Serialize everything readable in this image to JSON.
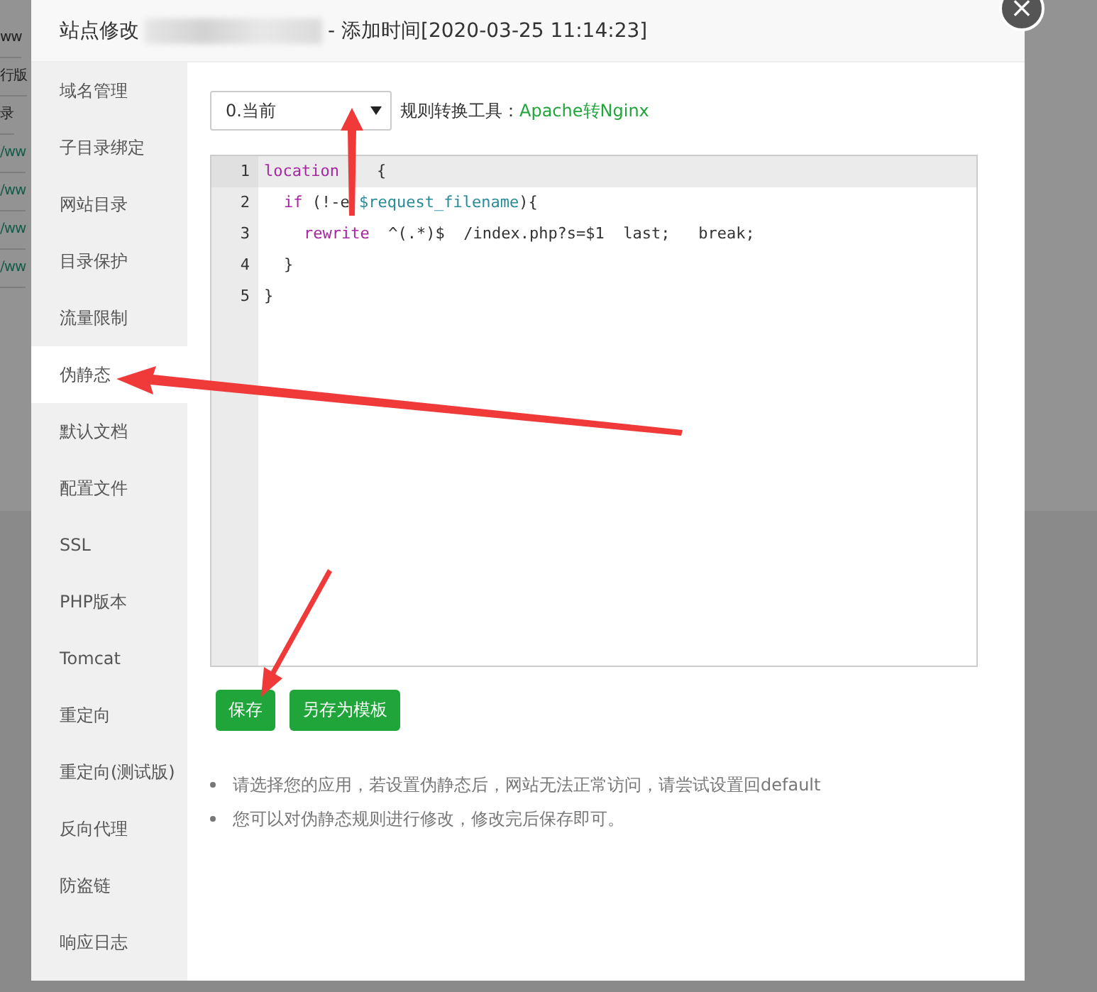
{
  "background": {
    "fragments": [
      "ww",
      "行版",
      "录",
      "/ww",
      "/ww",
      "/ww",
      "/ww"
    ]
  },
  "dialog": {
    "title_prefix": "站点修改",
    "title_suffix": "- 添加时间[2020-03-25 11:14:23]",
    "close": "×"
  },
  "sidebar": {
    "items": [
      {
        "label": "域名管理",
        "selected": false
      },
      {
        "label": "子目录绑定",
        "selected": false
      },
      {
        "label": "网站目录",
        "selected": false
      },
      {
        "label": "目录保护",
        "selected": false
      },
      {
        "label": "流量限制",
        "selected": false
      },
      {
        "label": "伪静态",
        "selected": true
      },
      {
        "label": "默认文档",
        "selected": false
      },
      {
        "label": "配置文件",
        "selected": false
      },
      {
        "label": "SSL",
        "selected": false
      },
      {
        "label": "PHP版本",
        "selected": false
      },
      {
        "label": "Tomcat",
        "selected": false
      },
      {
        "label": "重定向",
        "selected": false
      },
      {
        "label": "重定向(测试版)",
        "selected": false
      },
      {
        "label": "反向代理",
        "selected": false
      },
      {
        "label": "防盗链",
        "selected": false
      },
      {
        "label": "响应日志",
        "selected": false
      }
    ]
  },
  "rewrite": {
    "template_select": {
      "value": "0.当前"
    },
    "tool_label": "规则转换工具：",
    "tool_link": "Apache转Nginx",
    "editor": {
      "lines": [
        {
          "number": "1",
          "tokens": [
            {
              "kind": "keyword",
              "text": "location"
            },
            {
              "kind": "plain",
              "text": "    {"
            }
          ],
          "children": [
            {
              "number": "2",
              "tokens": [
                {
                  "kind": "keyword",
                  "text": "if"
                },
                {
                  "kind": "plain",
                  "text": " (!-e "
                },
                {
                  "kind": "variable",
                  "text": "$request_filename"
                },
                {
                  "kind": "plain",
                  "text": "){"
                }
              ],
              "children": [
                {
                  "number": "3",
                  "tokens": [
                    {
                      "kind": "keyword",
                      "text": "rewrite"
                    },
                    {
                      "kind": "plain",
                      "text": "  ^(.*)$  /index.php?s=$1  last;   break;"
                    }
                  ]
                }
              ]
            },
            {
              "number": "4",
              "tokens": [
                {
                  "kind": "plain",
                  "text": "}"
                }
              ]
            }
          ]
        },
        {
          "number": "5",
          "tokens": [
            {
              "kind": "plain",
              "text": "}"
            }
          ]
        }
      ]
    },
    "buttons": [
      "保存",
      "另存为模板"
    ],
    "notes": [
      "请选择您的应用，若设置伪静态后，网站无法正常访问，请尝试设置回default",
      "您可以对伪静态规则进行修改，修改完后保存即可。"
    ]
  }
}
